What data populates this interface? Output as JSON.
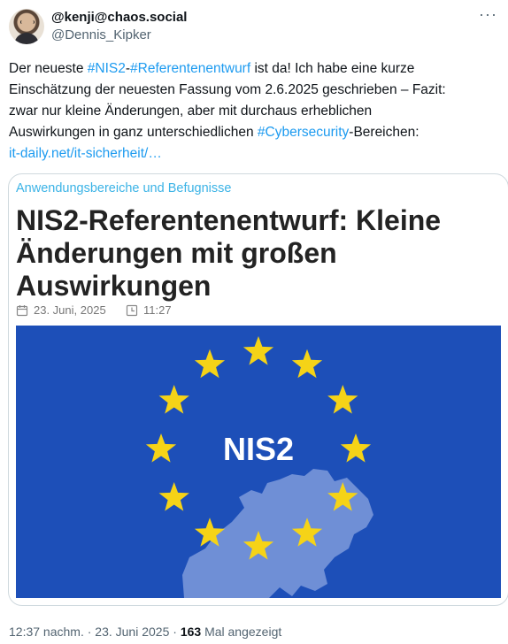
{
  "author": {
    "display_name": "@kenji@chaos.social",
    "handle": "@Dennis_Kipker",
    "avatar_icon": "profile-photo"
  },
  "more_icon": "ellipsis-icon",
  "tweet": {
    "lines": [
      {
        "p1": "Der neueste ",
        "tag1": "#NIS2",
        "p2": "-",
        "tag2": "#Referentenentwurf",
        "p3": " ist da! Ich habe eine kurze"
      },
      {
        "text": "Einschätzung der neuesten Fassung vom 2.6.2025 geschrieben – Fazit:"
      },
      {
        "text": "zwar nur kleine Änderungen, aber mit durchaus erheblichen"
      },
      {
        "p1": "Auswirkungen in ganz unterschiedlichen ",
        "tag1": "#Cybersecurity",
        "p2": "-Bereichen:"
      },
      {
        "link": "it-daily.net/it-sicherheit/…"
      }
    ]
  },
  "card": {
    "category": "Anwendungsbereiche und Befugnisse",
    "title_lines": [
      "NIS2-Referentenentwurf: Kleine",
      "Änderungen mit großen",
      "Auswirkungen"
    ],
    "date": "23. Juni, 2025",
    "time": "11:27",
    "image": {
      "text": "NIS2",
      "background": "#1d4fb8",
      "star_color": "#f5d317",
      "map_color": "#6f8fd6"
    }
  },
  "footer": {
    "time": "12:37 nachm.",
    "date": "23. Juni 2025",
    "sep": " · ",
    "views": "163",
    "views_label": " Mal angezeigt"
  }
}
